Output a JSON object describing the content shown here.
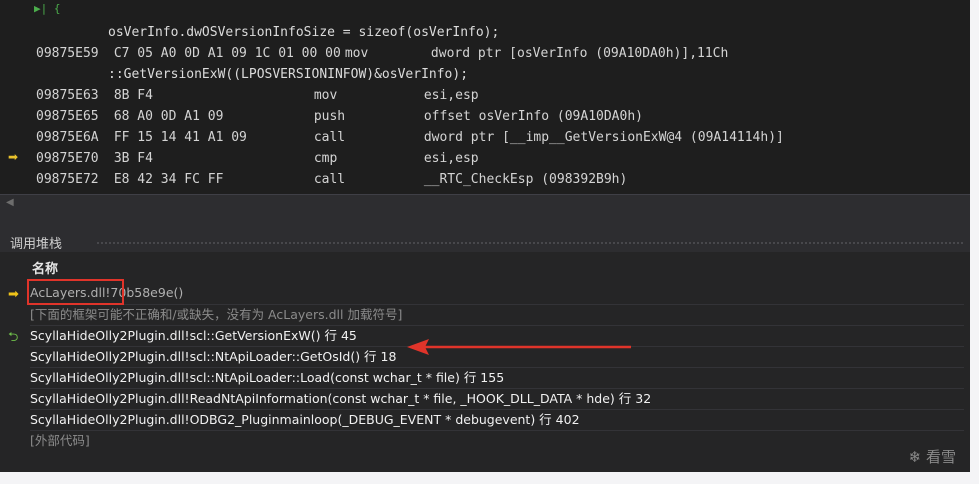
{
  "disassembly": {
    "lines": [
      {
        "type": "src",
        "text": "osVerInfo.dwOSVersionInfoSize = sizeof(osVerInfo);"
      },
      {
        "type": "asm",
        "addr": "09875E59",
        "bytes": "C7 05 A0 0D A1 09 1C 01 00 00",
        "mnem": "mov",
        "operand": "        dword ptr [osVerInfo (09A10DA0h)],11Ch"
      },
      {
        "type": "src",
        "text": "::GetVersionExW((LPOSVERSIONINFOW)&osVerInfo);"
      },
      {
        "type": "asm",
        "addr": "09875E63",
        "bytes": "8B F4",
        "mnem": "mov",
        "operand": "esi,esp"
      },
      {
        "type": "asm",
        "addr": "09875E65",
        "bytes": "68 A0 0D A1 09",
        "mnem": "push",
        "operand": "offset osVerInfo (09A10DA0h)"
      },
      {
        "type": "asm",
        "addr": "09875E6A",
        "bytes": "FF 15 14 41 A1 09",
        "mnem": "call",
        "operand": "dword ptr [__imp__GetVersionExW@4 (09A14114h)]"
      },
      {
        "type": "asm",
        "addr": "09875E70",
        "bytes": "3B F4",
        "mnem": "cmp",
        "operand": "esi,esp"
      },
      {
        "type": "asm",
        "addr": "09875E72",
        "bytes": "E8 42 34 FC FF",
        "mnem": "call",
        "operand": "__RTC_CheckEsp (098392B9h)"
      }
    ]
  },
  "call_stack": {
    "title": "调用堆栈",
    "column_header": "名称",
    "rows": [
      {
        "text": "AcLayers.dll!70b58e9e()",
        "marker": "current"
      },
      {
        "text": "[下面的框架可能不正确和/或缺失，没有为 AcLayers.dll 加载符号]",
        "marker": "none"
      },
      {
        "text": "ScyllaHideOlly2Plugin.dll!scl::GetVersionExW() 行 45",
        "marker": "return"
      },
      {
        "text": "ScyllaHideOlly2Plugin.dll!scl::NtApiLoader::GetOsId() 行 18",
        "marker": "none"
      },
      {
        "text": "ScyllaHideOlly2Plugin.dll!scl::NtApiLoader::Load(const wchar_t * file) 行 155",
        "marker": "none"
      },
      {
        "text": "ScyllaHideOlly2Plugin.dll!ReadNtApiInformation(const wchar_t * file, _HOOK_DLL_DATA * hde) 行 32",
        "marker": "none"
      },
      {
        "text": "ScyllaHideOlly2Plugin.dll!ODBG2_Pluginmainloop(_DEBUG_EVENT * debugevent) 行 402",
        "marker": "none"
      },
      {
        "text": "[外部代码]",
        "marker": "none"
      }
    ]
  },
  "watermark": "看雪",
  "colors": {
    "annotation": "#e0342a",
    "current_frame": "#f0c419",
    "return_frame": "#6fbf4a"
  },
  "icons": {
    "current": "yellow-arrow-icon",
    "return": "green-return-icon",
    "scroll": "scroll-left-icon"
  }
}
